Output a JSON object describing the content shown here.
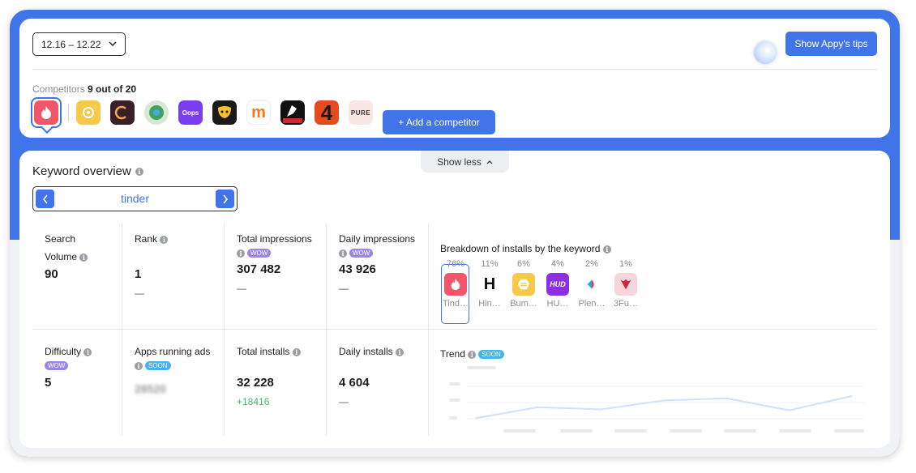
{
  "header": {
    "date_range": "12.16 – 12.22",
    "tips_label": "Show Appy's tips",
    "competitors_label": "Competitors",
    "competitors_count": "9 out of 20",
    "add_competitor_label": "+ Add a competitor"
  },
  "competitor_apps": [
    {
      "name": "tinder",
      "color": "#f0556a"
    },
    {
      "name": "bumble",
      "color": "#f7c948"
    },
    {
      "name": "app-3",
      "color": "#3a1f2b"
    },
    {
      "name": "app-4",
      "color": "#3da35d"
    },
    {
      "name": "oops",
      "color": "#7b3df0"
    },
    {
      "name": "grindr",
      "color": "#f6c02a"
    },
    {
      "name": "mamba",
      "color": "#f27a1a"
    },
    {
      "name": "free-app",
      "color": "#111111"
    },
    {
      "name": "app-4-logo",
      "color": "#e64a1f"
    },
    {
      "name": "pure",
      "color": "#f3dad6"
    }
  ],
  "keyword_section": {
    "show_less_label": "Show less",
    "title": "Keyword overview",
    "keyword": "tinder"
  },
  "metrics": {
    "search_volume": {
      "label": "Search Volume",
      "value": "90"
    },
    "rank": {
      "label": "Rank",
      "value": "1",
      "sub": "—"
    },
    "total_impressions": {
      "label": "Total impressions",
      "badge": "WOW",
      "value": "307 482",
      "sub": "—"
    },
    "daily_impressions": {
      "label": "Daily impressions",
      "badge": "WOW",
      "value": "43 926",
      "sub": "—"
    },
    "difficulty": {
      "label": "Difficulty",
      "badge": "WOW",
      "value": "5"
    },
    "apps_running_ads": {
      "label": "Apps running ads",
      "badge": "SOON",
      "value": "28520"
    },
    "total_installs": {
      "label": "Total installs",
      "value": "32 228",
      "sub": "+18416"
    },
    "daily_installs": {
      "label": "Daily installs",
      "value": "4 604",
      "sub": "—"
    }
  },
  "breakdown": {
    "title": "Breakdown of installs by the keyword",
    "items": [
      {
        "pct": "76%",
        "name": "Tind…",
        "color": "#f0556a"
      },
      {
        "pct": "11%",
        "name": "Hin…",
        "color": "#ffffff"
      },
      {
        "pct": "6%",
        "name": "Bum…",
        "color": "#f7c948"
      },
      {
        "pct": "4%",
        "name": "HU…",
        "color": "#8b2fe0"
      },
      {
        "pct": "2%",
        "name": "Plen…",
        "color": "#ffffff"
      },
      {
        "pct": "1%",
        "name": "3Fu…",
        "color": "#f6d6dc"
      }
    ]
  },
  "trend": {
    "title": "Trend",
    "badge": "SOON",
    "line_color": "#cfe0fb",
    "points": [
      0.1,
      0.35,
      0.3,
      0.5,
      0.55,
      0.28,
      0.6
    ]
  }
}
